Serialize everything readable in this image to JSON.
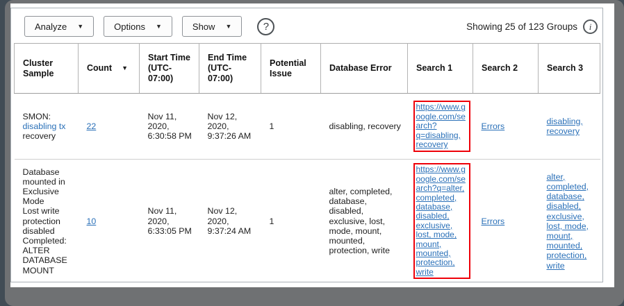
{
  "toolbar": {
    "analyze_label": "Analyze",
    "options_label": "Options",
    "show_label": "Show",
    "caret_icon": "▼",
    "help_icon": "?",
    "showing_text": "Showing 25 of 123 Groups",
    "info_icon": "i"
  },
  "table": {
    "columns": [
      "Cluster Sample",
      "Count",
      "Start Time (UTC-07:00)",
      "End Time (UTC-07:00)",
      "Potential Issue",
      "Database Error",
      "Search 1",
      "Search 2",
      "Search 3"
    ],
    "sort": {
      "column": "Count",
      "direction": "descending",
      "icon": "▼"
    },
    "rows": [
      {
        "cluster_sample_prefix": "SMON: ",
        "cluster_sample_highlight": "disabling tx",
        "cluster_sample_suffix": " recovery",
        "count": "22",
        "start_time": "Nov 11, 2020, 6:30:58 PM",
        "end_time": "Nov 12, 2020, 9:37:26 AM",
        "potential_issue": "1",
        "database_error": "disabling, recovery",
        "search_1_link": "https://www.google.com/search?q=disabling, recovery",
        "search_2_link": "Errors",
        "search_3_link": "disabling, recovery"
      },
      {
        "cluster_sample_lines": {
          "0": "Database mounted in Exclusive Mode",
          "1": "Lost write protection disabled",
          "2": "Completed: ALTER DATABASE MOUNT"
        },
        "count": "10",
        "start_time": "Nov 11, 2020, 6:33:05 PM",
        "end_time": "Nov 12, 2020, 9:37:24 AM",
        "potential_issue": "1",
        "database_error": "alter, completed, database, disabled, exclusive, lost, mode, mount, mounted, protection, write",
        "search_1_link": "https://www.google.com/search?q=alter, completed, database, disabled, exclusive, lost, mode, mount, mounted, protection, write",
        "search_2_link": "Errors",
        "search_3_link": "alter, completed, database, disabled, exclusive, lost, mode, mount, mounted, protection, write"
      }
    ]
  },
  "colors": {
    "backdrop_slate": "#414c55",
    "gutter_gray": "#6f7173",
    "panel_border": "#a9b0b6",
    "link_blue": "#2a70b8",
    "annotation_red": "#ee0008"
  }
}
